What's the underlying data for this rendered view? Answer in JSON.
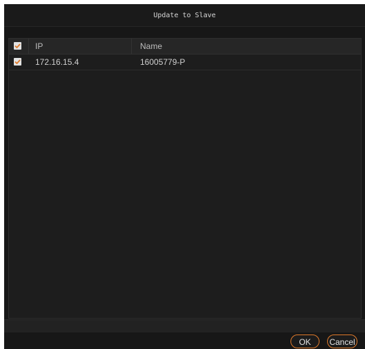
{
  "dialog": {
    "title": "Update to Slave"
  },
  "table": {
    "columns": {
      "checkbox": "",
      "ip": "IP",
      "name": "Name"
    },
    "header_checked": true,
    "rows": [
      {
        "checked": true,
        "ip": "172.16.15.4",
        "name": "16005779-P"
      }
    ]
  },
  "buttons": {
    "ok": "OK",
    "cancel": "Cancel"
  },
  "colors": {
    "accent": "#e07a2a",
    "background": "#171717"
  },
  "icons": {
    "checkbox": "checkmark-icon"
  }
}
